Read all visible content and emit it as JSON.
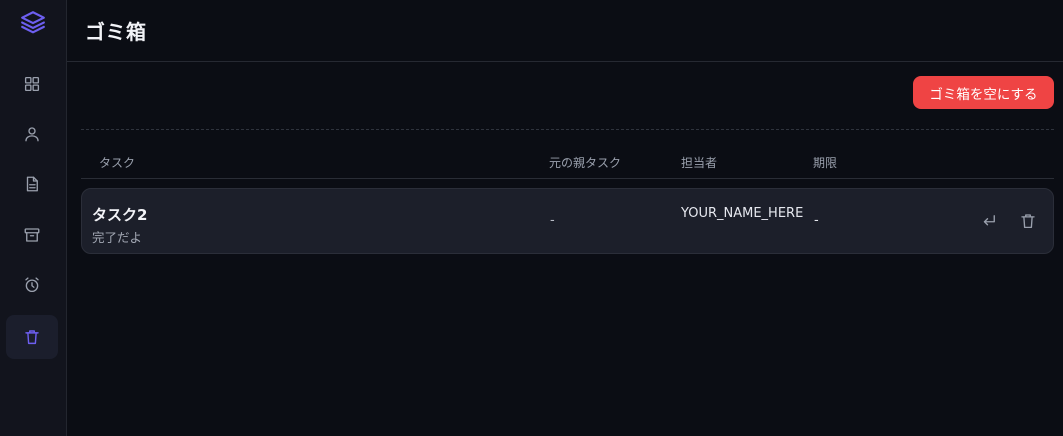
{
  "colors": {
    "accent": "#6d5ff0",
    "danger": "#ef4444",
    "background": "#0b0d14",
    "sidebar": "#12141d",
    "row": "#1c1f2a"
  },
  "sidebar": {
    "logo_icon": "layers-icon",
    "items": [
      {
        "id": "dashboard",
        "icon": "grid-icon",
        "active": false
      },
      {
        "id": "users",
        "icon": "user-icon",
        "active": false
      },
      {
        "id": "documents",
        "icon": "document-icon",
        "active": false
      },
      {
        "id": "archive",
        "icon": "archive-icon",
        "active": false
      },
      {
        "id": "alarm",
        "icon": "alarm-icon",
        "active": false
      },
      {
        "id": "trash",
        "icon": "trash-icon",
        "active": true
      }
    ]
  },
  "header": {
    "title": "ゴミ箱"
  },
  "toolbar": {
    "empty_trash_label": "ゴミ箱を空にする"
  },
  "table": {
    "columns": [
      "タスク",
      "元の親タスク",
      "担当者",
      "期限"
    ],
    "rows": [
      {
        "title": "タスク2",
        "description": "完了だよ",
        "parent_task": "-",
        "assignee": "YOUR_NAME_HERE",
        "due": "-",
        "actions": [
          "restore-icon",
          "trash-icon"
        ]
      }
    ]
  }
}
